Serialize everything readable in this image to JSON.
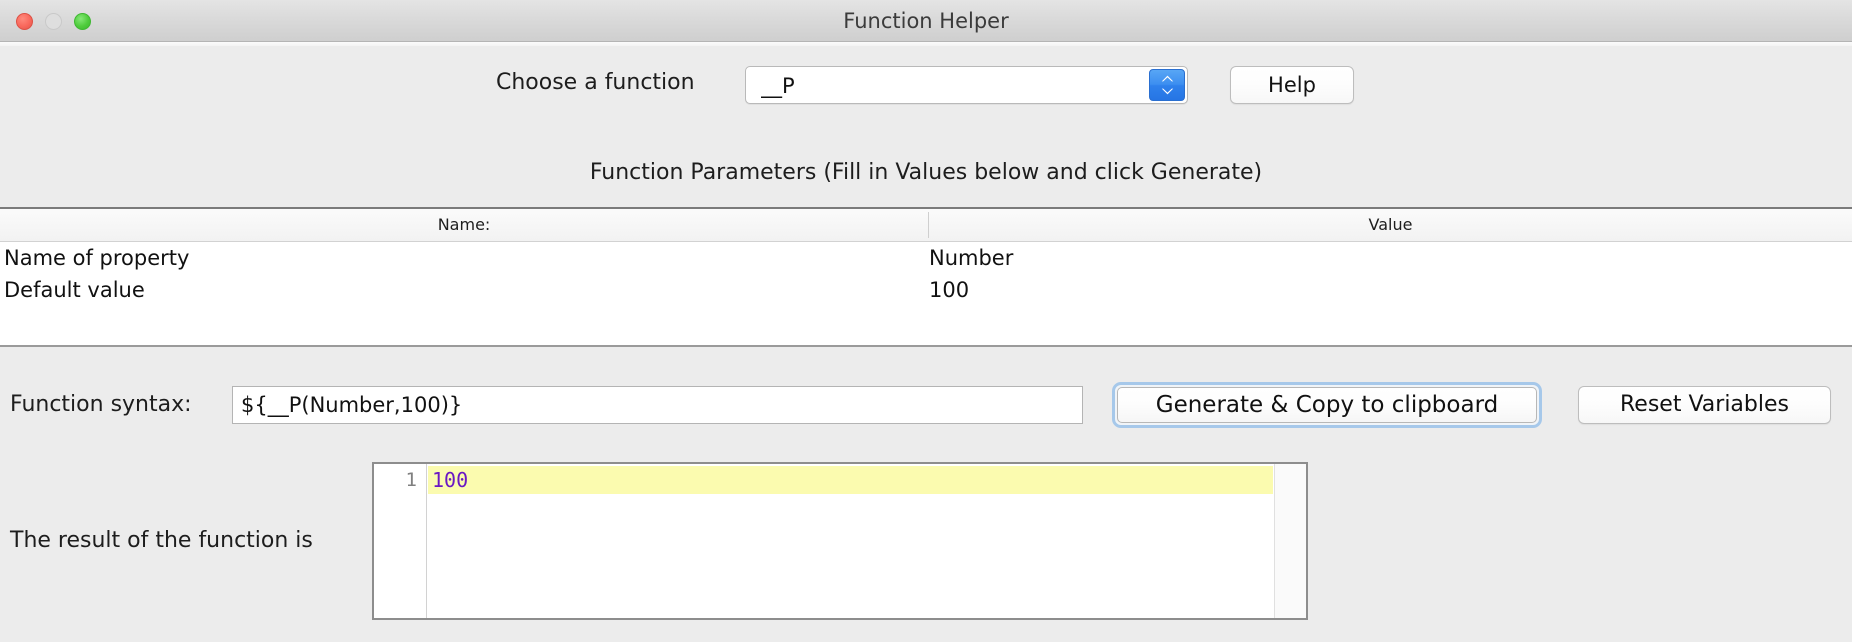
{
  "window": {
    "title": "Function Helper",
    "traffic_lights": [
      {
        "name": "close",
        "color": "#f9685c"
      },
      {
        "name": "minimize",
        "color": "#dedede"
      },
      {
        "name": "zoom",
        "color": "#4fcc3c"
      }
    ]
  },
  "toolbar": {
    "choose_label": "Choose a function",
    "function_value": "__P",
    "function_placeholder": "__P",
    "stepper_icon": "chevron-up-down-icon",
    "stepper_color": "#2f81ec",
    "help_label": "Help"
  },
  "parameters": {
    "heading": "Function Parameters (Fill in Values below and click Generate)",
    "columns": [
      "Name:",
      "Value"
    ],
    "rows": [
      {
        "name": "Name of property",
        "value": "Number"
      },
      {
        "name": "Default value",
        "value": "100"
      }
    ]
  },
  "syntax": {
    "label": "Function syntax:",
    "value": "${__P(Number,100)}",
    "placeholder": "${__P(Number,100)}",
    "generate_label": "Generate & Copy to clipboard",
    "reset_label": "Reset Variables",
    "focus_color": "#a6c8ea"
  },
  "result": {
    "label": "The result of the function is",
    "line_number": "1",
    "text": "100",
    "text_color": "#6a17c4",
    "highlight_color": "#fbfbaf"
  }
}
